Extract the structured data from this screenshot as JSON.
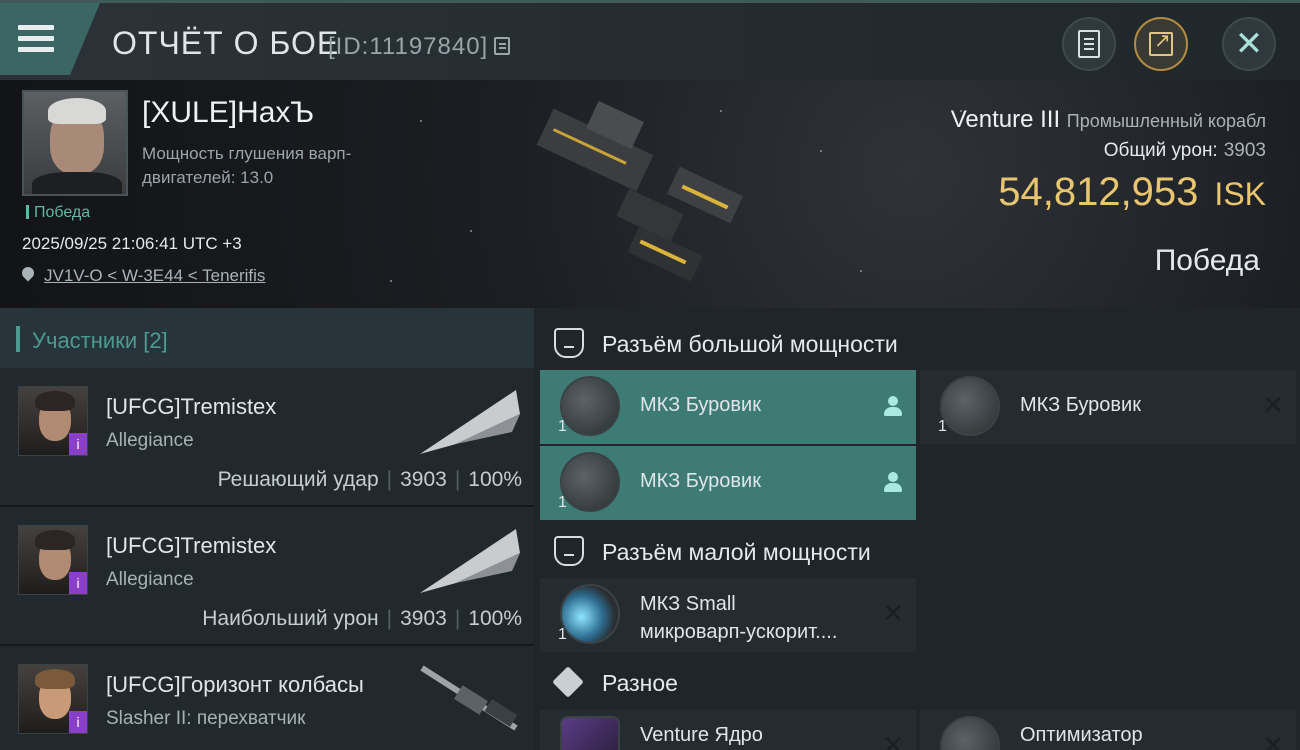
{
  "header": {
    "title": "ОТЧЁТ О БОЕ",
    "report_id": "[ID:11197840]"
  },
  "victim": {
    "name": "[XULE]HaxЪ",
    "stat_label": "Мощность глушения варп-двигателей: 13.0",
    "result_tag": "Победа",
    "datetime": "2025/09/25 21:06:41 UTC +3",
    "location": "JV1V-O < W-3E44 < Tenerifis",
    "ship_name": "Venture III",
    "ship_class": "Промышленный корабл",
    "damage_label": "Общий урон:",
    "damage_value": "3903",
    "isk_value": "54,812,953",
    "isk_currency": "ISK",
    "outcome": "Победа"
  },
  "participants": {
    "header": "Участники [2]",
    "rows": [
      {
        "name": "[UFCG]Tremistex",
        "ship": "Allegiance",
        "role": "Решающий удар",
        "damage": "3903",
        "percent": "100%"
      },
      {
        "name": "[UFCG]Tremistex",
        "ship": "Allegiance",
        "role": "Наибольший урон",
        "damage": "3903",
        "percent": "100%"
      },
      {
        "name": "[UFCG]Горизонт колбасы",
        "ship": "Slasher II: перехватчик",
        "role": "",
        "damage": "",
        "percent": ""
      }
    ]
  },
  "fitting": {
    "high_slots_title": "Разъём большой мощности",
    "low_slots_title": "Разъём малой мощности",
    "misc_title": "Разное",
    "high_slots": [
      {
        "name": "МКЗ Буровик",
        "qty": "1",
        "state": "active"
      },
      {
        "name": "МКЗ Буровик",
        "qty": "1",
        "state": "destroyed"
      },
      {
        "name": "МКЗ Буровик",
        "qty": "1",
        "state": "active"
      }
    ],
    "low_slots": [
      {
        "name_line1": "МКЗ Small",
        "name_line2": "микроварп-ускорит....",
        "qty": "1",
        "state": "destroyed"
      }
    ],
    "misc": [
      {
        "name": "Venture Ядро",
        "state": "destroyed"
      },
      {
        "name": "Оптимизатор",
        "state": "destroyed"
      }
    ]
  },
  "colors": {
    "accent_teal": "#3d7b74",
    "isk_gold": "#e8c56f",
    "victory_green": "#5fb8a6"
  }
}
